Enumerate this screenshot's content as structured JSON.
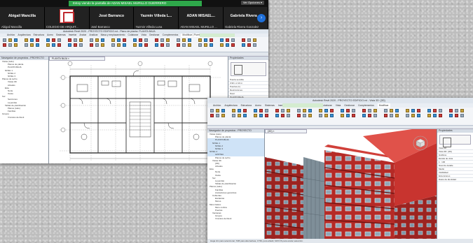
{
  "zoom": {
    "share_notice": "Estoy viendo la pantalla de ADAN MISAEL MURILLO GUERRERO",
    "options_button": "Ver Opciones ▾",
    "next_icon": "chevron-right-icon",
    "participants": [
      {
        "name": "Abigail Mancilla",
        "footer": "Abigail Mancilla",
        "logo": false
      },
      {
        "name": "",
        "footer": "COLEGIO DE ARQUIT...",
        "logo": true
      },
      {
        "name": "José Barranco",
        "footer": "José Barranco",
        "logo": false
      },
      {
        "name": "Yazmin Villeda L...",
        "footer": "Yazmin Villeda Luna",
        "logo": false
      },
      {
        "name": "ADAN MISAEL...",
        "footer": "ADAN MISAEL MURILLO ...",
        "logo": false
      },
      {
        "name": "Gabriela Rivera ...",
        "footer": "Gabriela Rivera Gonzalez",
        "logo": false
      }
    ]
  },
  "revit1": {
    "title": "Autodesk Revit 2020 - PROYECTO EDIFICIO.rvt - Plano de planta: PLANTA BAJA",
    "tabs": [
      "Archivo",
      "Arquitectura",
      "Estructura",
      "Acero",
      "Sistemas",
      "Insertar",
      "Anotar",
      "Analizar",
      "Masa y emplazamiento",
      "Colaborar",
      "Vista",
      "Gestionar",
      "Complementos",
      "Modificar | Puertas"
    ],
    "view_tab": "PLANTA BAJA ×",
    "browser_title": "Navegador de proyectos - PROYECTO",
    "tree": [
      "Vistas (todo)",
      "Planos de planta",
      "PLANTA BAJA",
      "NIVEL 1",
      "NIVEL 2",
      "NIVEL 3",
      "Planos de techo",
      "Vistas 3D",
      "Alzados",
      "Este",
      "Norte",
      "Oeste",
      "Sur",
      "Secciones",
      "Leyendas",
      "Tablas de planificación",
      "Planos (todo)",
      "Familias",
      "Grupos",
      "Vínculos de Revit"
    ],
    "props_title": "Propiedades",
    "props": [
      "Puerta sencilla",
      "0.90 x 2.10 m",
      "Puertas (1)",
      "Restricciones",
      "Nivel",
      "PLANTA BAJA",
      "Altura de dintel",
      "Gráficos",
      "Datos de identidad",
      "Fases"
    ]
  },
  "revit2": {
    "title": "Autodesk Revit 2020 - PROYECTO EDIFICIO.rvt - Vista 3D: {3D}",
    "tabs": [
      "Archivo",
      "Arquitectura",
      "Estructura",
      "Acero",
      "Sistemas",
      "Insertar",
      "Anotar",
      "Analizar",
      "Masa",
      "Colaborar",
      "Vista",
      "Gestionar",
      "Complementos",
      "Modificar"
    ],
    "view_tab": "{3D} ×",
    "browser_title": "Navegador de proyectos - PROYECTO",
    "tree": [
      "Vistas (todo)",
      "Planos de planta",
      "PLANTA BAJA",
      "NIVEL 1",
      "NIVEL 2",
      "NIVEL 3",
      "NIVEL 4",
      "AZOTEA",
      "Planos de techo",
      "Vistas 3D",
      "{3D}",
      "Alzados",
      "Este",
      "Norte",
      "Oeste",
      "Sur",
      "Leyendas",
      "Tablas de planificación",
      "Planos (todo)",
      "Familias",
      "Anotaciones genéricas",
      "Cubiertas",
      "Escaleras",
      "Muros",
      "Muro básico",
      "Muro cortina",
      "Puertas",
      "Ventanas",
      "Grupos",
      "Vínculos de Revit"
    ],
    "props_title": "Propiedades",
    "props": [
      "Vista 3D",
      "Vista 3D: {3D}",
      "Gráficos",
      "Escala de vista",
      "1 : 100",
      "Nivel de detalle",
      "Medio",
      "Visibilidad",
      "Extensiones",
      "Datos de identidad"
    ],
    "status": "Haga clic para seleccionar, TAB para alternativas, CTRL para añadir, MAYÚS para anular selección."
  },
  "colors": {
    "building_red": "#b52a26",
    "building_dark": "#7a1512",
    "glass": "#8fa7b8",
    "revit_green": "#d4ecd0",
    "zoom_green": "#2ea84a"
  }
}
